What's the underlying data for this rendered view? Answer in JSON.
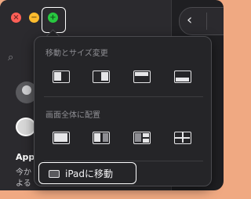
{
  "window_controls": {
    "close": "close-icon",
    "minimize": "minimize-icon",
    "zoom": "zoom-icon",
    "colors": {
      "close": "#ff5f57",
      "minimize": "#febc2e",
      "zoom": "#28c840"
    }
  },
  "sidebar": {
    "item_title": "App",
    "item_sub1": "今か",
    "item_sub2": "よる"
  },
  "nav": {
    "back_glyph": "‹"
  },
  "menu": {
    "section_move_resize": "移動とサイズ変更",
    "section_fill": "画面全体に配置",
    "move_resize_tiles": [
      "left-half-icon",
      "right-half-icon",
      "top-half-icon",
      "bottom-half-icon"
    ],
    "fill_tiles": [
      "fill-screen-icon",
      "split-left-right-icon",
      "left-and-right-stack-icon",
      "quarters-icon"
    ],
    "ipad_label": "iPadに移動"
  },
  "colors": {
    "accent_outline": "#ffffff",
    "menu_bg": "#252528",
    "backdrop": "#f0a982"
  }
}
